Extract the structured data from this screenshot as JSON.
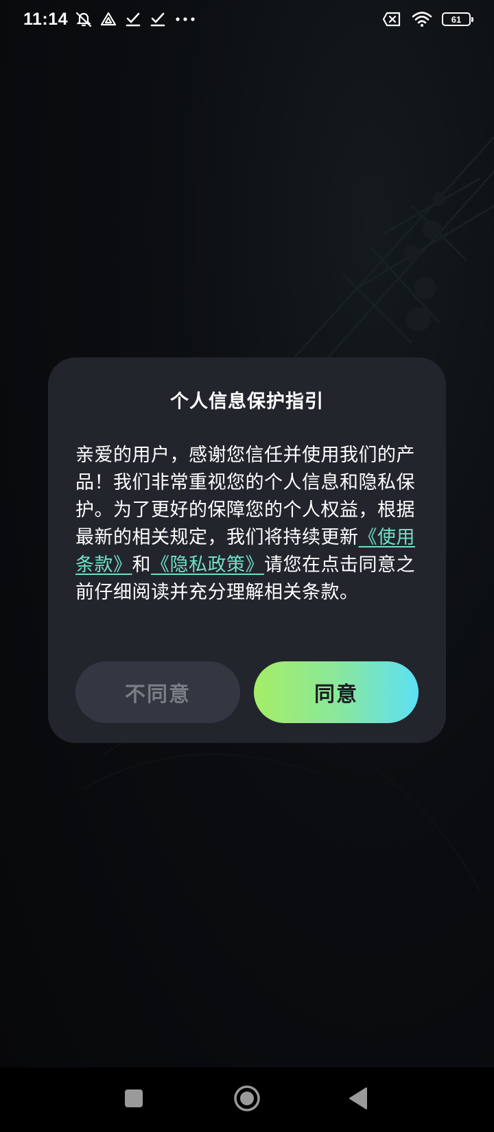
{
  "status_bar": {
    "time": "11:14",
    "battery_level": "61",
    "left_icons": [
      "mute-notification-icon",
      "drive-icon",
      "check-icon",
      "check-icon",
      "more-dots-icon"
    ],
    "right_icons": [
      "no-sim-icon",
      "wifi-icon",
      "battery-icon"
    ]
  },
  "dialog": {
    "title": "个人信息保护指引",
    "body_intro": "亲爱的用户，感谢您信任并使用我们的产品！我们非常重视您的个人信息和隐私保护。为了更好的保障您的个人权益，根据最新的相关规定，我们将持续更新",
    "terms_link": "《使用条款》",
    "and_text": "和",
    "privacy_link": "《隐私政策》",
    "body_outro": "请您在点击同意之前仔细阅读并充分理解相关条款。",
    "disagree_label": "不同意",
    "agree_label": "同意"
  },
  "colors": {
    "dialog_bg": "#23252d",
    "link": "#6ee0c8",
    "agree_gradient_start": "#a4ee66",
    "agree_gradient_end": "#5ce0f5",
    "disagree_bg": "#343641"
  },
  "nav_bar": {
    "icons": [
      "recents-square-icon",
      "home-circle-icon",
      "back-triangle-icon"
    ]
  }
}
